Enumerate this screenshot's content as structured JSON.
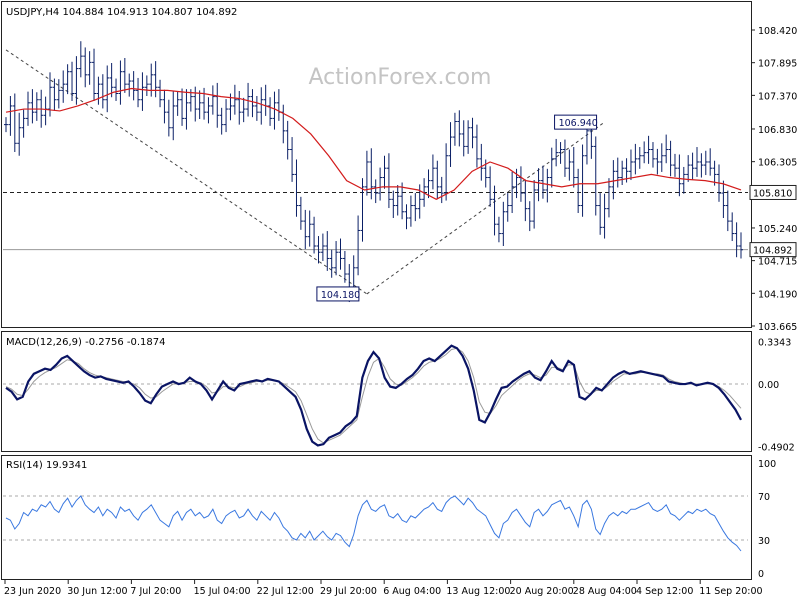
{
  "symbol_header": "USDJPY,H4  104.884 104.913 104.807 104.892",
  "watermark": "ActionForex.com",
  "colors": {
    "bar": "#0a1f66",
    "ma": "#d31c1c",
    "macd": "#0a1464",
    "signal": "#9a9a9a",
    "rsi": "#3a78e0",
    "label_fill": "#ffffff",
    "label_bg_dark": "#0a1464"
  },
  "chart_data": [
    {
      "type": "line",
      "title": "USDJPY,H4  104.884 104.913 104.807 104.892",
      "ylim": [
        103.665,
        108.42
      ],
      "y_ticks": [
        "108.420",
        "107.895",
        "107.370",
        "106.830",
        "106.305",
        "105.240",
        "104.715",
        "104.190",
        "103.665"
      ],
      "y_tick_values": [
        108.42,
        107.895,
        107.37,
        106.83,
        106.305,
        105.24,
        104.715,
        104.19,
        103.665
      ],
      "x_ticks": [
        "23 Jun 2020",
        "30 Jun 12:00",
        "7 Jul 20:00",
        "15 Jul 04:00",
        "22 Jul 12:00",
        "29 Jul 20:00",
        "6 Aug 04:00",
        "13 Aug 12:00",
        "20 Aug 20:00",
        "28 Aug 04:00",
        "4 Sep 12:00",
        "11 Sep 20:00"
      ],
      "series": [
        {
          "kind": "ohlc-bars",
          "close": [
            106.9,
            107.2,
            106.6,
            106.85,
            107.0,
            107.25,
            107.1,
            107.3,
            107.05,
            107.15,
            107.5,
            107.3,
            107.45,
            107.55,
            107.75,
            107.4,
            107.8,
            108.0,
            107.7,
            107.9,
            107.4,
            107.55,
            107.3,
            107.65,
            107.5,
            107.4,
            107.75,
            107.55,
            107.6,
            107.45,
            107.3,
            107.5,
            107.55,
            107.7,
            107.5,
            107.3,
            107.1,
            106.85,
            107.2,
            107.3,
            107.0,
            107.25,
            107.35,
            107.15,
            107.25,
            107.1,
            107.2,
            107.35,
            107.05,
            106.9,
            107.15,
            107.2,
            107.3,
            107.1,
            107.15,
            107.35,
            107.2,
            107.1,
            107.3,
            107.2,
            107.0,
            107.25,
            107.1,
            106.8,
            106.5,
            106.1,
            105.6,
            105.35,
            105.1,
            105.3,
            104.95,
            104.85,
            104.95,
            104.75,
            104.6,
            104.85,
            104.75,
            104.5,
            104.25,
            104.6,
            105.2,
            105.9,
            106.3,
            105.9,
            105.8,
            106.05,
            106.2,
            105.7,
            105.6,
            105.75,
            105.5,
            105.4,
            105.6,
            105.55,
            105.7,
            105.9,
            106.0,
            106.2,
            105.9,
            105.8,
            106.4,
            106.7,
            106.95,
            106.75,
            106.55,
            106.85,
            106.7,
            106.35,
            106.2,
            106.05,
            105.7,
            105.3,
            105.15,
            105.5,
            105.6,
            105.9,
            106.05,
            105.8,
            105.55,
            105.35,
            105.85,
            106.0,
            105.85,
            106.05,
            106.35,
            106.45,
            106.5,
            106.2,
            106.3,
            106.05,
            105.6,
            106.4,
            106.8,
            106.55,
            105.6,
            105.25,
            105.55,
            105.9,
            106.15,
            106.05,
            106.2,
            106.15,
            106.3,
            106.35,
            106.4,
            106.45,
            106.5,
            106.35,
            106.3,
            106.4,
            106.5,
            106.25,
            106.2,
            105.95,
            106.1,
            106.25,
            106.2,
            106.3,
            106.25,
            106.3,
            106.2,
            106.1,
            105.8,
            105.6,
            105.35,
            105.15,
            104.95,
            104.89
          ],
          "low_marked": 104.18,
          "high_marked": 106.94
        },
        {
          "kind": "moving-average",
          "values": [
            107.1,
            107.15,
            107.15,
            107.12,
            107.2,
            107.3,
            107.42,
            107.48,
            107.45,
            107.45,
            107.42,
            107.4,
            107.35,
            107.32,
            107.25,
            107.15,
            107.0,
            106.75,
            106.4,
            106.0,
            105.85,
            105.9,
            105.9,
            105.85,
            105.7,
            105.85,
            106.15,
            106.3,
            106.2,
            106.0,
            105.95,
            105.9,
            105.95,
            105.95,
            106.0,
            106.05,
            106.1,
            106.05,
            106.02,
            106.0,
            105.95,
            105.85
          ],
          "segments": 42
        }
      ],
      "horizontal_lines": [
        {
          "value": 105.81,
          "style": "dashed",
          "label": "105.810"
        },
        {
          "value": 104.892,
          "style": "solid",
          "label": "104.892"
        }
      ],
      "annotations": [
        {
          "text": "106.940",
          "y": 106.94
        },
        {
          "text": "104.180",
          "y": 104.18
        }
      ],
      "trendlines": [
        {
          "from": [
            0,
            108.1
          ],
          "to": [
            82,
            104.18
          ]
        },
        {
          "from": [
            82,
            104.18
          ],
          "to": [
            136,
            106.94
          ]
        }
      ]
    },
    {
      "type": "line",
      "title": "MACD(12,26,9) -0.2756 -0.1874",
      "ylim": [
        -0.5,
        0.36
      ],
      "y_ticks": [
        "0.3343",
        "0.00",
        "-0.4902"
      ],
      "y_tick_values": [
        0.3343,
        0.0,
        -0.4902
      ],
      "series": [
        {
          "name": "MACD",
          "values": [
            -0.03,
            -0.06,
            -0.12,
            -0.1,
            0.02,
            0.08,
            0.1,
            0.12,
            0.11,
            0.15,
            0.2,
            0.22,
            0.18,
            0.14,
            0.1,
            0.07,
            0.05,
            0.06,
            0.04,
            0.03,
            0.02,
            0.01,
            0.02,
            -0.02,
            -0.07,
            -0.13,
            -0.15,
            -0.08,
            -0.02,
            0.0,
            0.02,
            0.0,
            0.01,
            0.05,
            0.02,
            0.0,
            -0.05,
            -0.12,
            -0.05,
            0.02,
            -0.03,
            -0.05,
            0.0,
            0.01,
            0.02,
            0.03,
            0.02,
            0.04,
            0.03,
            0.02,
            -0.02,
            -0.06,
            -0.1,
            -0.2,
            -0.35,
            -0.45,
            -0.48,
            -0.47,
            -0.42,
            -0.4,
            -0.38,
            -0.33,
            -0.3,
            -0.25,
            0.05,
            0.18,
            0.25,
            0.2,
            0.05,
            -0.02,
            -0.03,
            0.0,
            0.04,
            0.07,
            0.12,
            0.18,
            0.2,
            0.18,
            0.22,
            0.26,
            0.3,
            0.28,
            0.22,
            0.12,
            -0.05,
            -0.28,
            -0.3,
            -0.22,
            -0.12,
            -0.03,
            -0.02,
            0.02,
            0.05,
            0.08,
            0.1,
            0.05,
            0.03,
            0.1,
            0.18,
            0.12,
            0.1,
            0.18,
            0.15,
            -0.1,
            -0.12,
            -0.08,
            -0.03,
            -0.05,
            0.0,
            0.05,
            0.08,
            0.1,
            0.08,
            0.09,
            0.1,
            0.09,
            0.08,
            0.07,
            0.06,
            0.02,
            0.01,
            0.0,
            0.0,
            0.01,
            -0.01,
            0.0,
            0.01,
            0.0,
            -0.03,
            -0.08,
            -0.14,
            -0.2,
            -0.28
          ]
        },
        {
          "name": "Signal",
          "values": [
            -0.02,
            -0.04,
            -0.08,
            -0.09,
            -0.04,
            0.02,
            0.06,
            0.09,
            0.11,
            0.13,
            0.16,
            0.19,
            0.18,
            0.16,
            0.12,
            0.09,
            0.07,
            0.06,
            0.05,
            0.04,
            0.03,
            0.02,
            0.01,
            0.0,
            -0.03,
            -0.08,
            -0.11,
            -0.1,
            -0.06,
            -0.03,
            0.0,
            0.0,
            0.01,
            0.02,
            0.02,
            0.01,
            -0.02,
            -0.07,
            -0.06,
            -0.02,
            -0.02,
            -0.03,
            -0.02,
            0.0,
            0.01,
            0.02,
            0.02,
            0.03,
            0.03,
            0.02,
            0.0,
            -0.03,
            -0.06,
            -0.13,
            -0.24,
            -0.35,
            -0.43,
            -0.46,
            -0.44,
            -0.42,
            -0.4,
            -0.36,
            -0.32,
            -0.28,
            -0.1,
            0.06,
            0.17,
            0.2,
            0.13,
            0.04,
            0.0,
            -0.01,
            0.02,
            0.05,
            0.09,
            0.14,
            0.17,
            0.18,
            0.2,
            0.23,
            0.27,
            0.28,
            0.25,
            0.18,
            0.05,
            -0.14,
            -0.22,
            -0.23,
            -0.17,
            -0.09,
            -0.05,
            -0.01,
            0.03,
            0.06,
            0.08,
            0.07,
            0.05,
            0.07,
            0.13,
            0.13,
            0.11,
            0.15,
            0.15,
            0.02,
            -0.06,
            -0.08,
            -0.05,
            -0.05,
            -0.02,
            0.02,
            0.05,
            0.08,
            0.08,
            0.08,
            0.09,
            0.09,
            0.08,
            0.08,
            0.07,
            0.04,
            0.02,
            0.01,
            0.0,
            0.0,
            0.0,
            0.0,
            0.0,
            0.0,
            -0.02,
            -0.05,
            -0.09,
            -0.14,
            -0.19
          ]
        }
      ]
    },
    {
      "type": "line",
      "title": "RSI(14) 19.9341",
      "ylim": [
        0,
        100
      ],
      "y_ticks": [
        "100",
        "70",
        "30",
        "0"
      ],
      "y_tick_values": [
        100,
        70,
        30,
        0
      ],
      "levels": [
        70,
        30
      ],
      "series": [
        {
          "name": "RSI",
          "values": [
            50,
            48,
            40,
            45,
            55,
            52,
            58,
            56,
            62,
            60,
            65,
            58,
            55,
            63,
            68,
            60,
            66,
            70,
            62,
            58,
            55,
            60,
            52,
            58,
            55,
            50,
            60,
            56,
            58,
            52,
            48,
            55,
            58,
            62,
            55,
            48,
            45,
            42,
            52,
            56,
            48,
            55,
            58,
            52,
            55,
            50,
            52,
            58,
            48,
            45,
            52,
            55,
            57,
            50,
            52,
            58,
            52,
            48,
            56,
            52,
            48,
            55,
            50,
            42,
            38,
            32,
            30,
            36,
            32,
            38,
            30,
            34,
            38,
            33,
            30,
            36,
            34,
            28,
            24,
            35,
            52,
            62,
            66,
            58,
            56,
            60,
            62,
            52,
            50,
            54,
            48,
            46,
            52,
            50,
            54,
            58,
            60,
            64,
            58,
            56,
            64,
            68,
            70,
            66,
            62,
            68,
            64,
            58,
            55,
            52,
            44,
            36,
            32,
            45,
            48,
            55,
            58,
            52,
            46,
            42,
            55,
            58,
            52,
            56,
            62,
            64,
            66,
            58,
            60,
            52,
            42,
            62,
            66,
            58,
            40,
            35,
            45,
            52,
            55,
            52,
            56,
            54,
            58,
            58,
            60,
            62,
            64,
            58,
            56,
            58,
            62,
            54,
            52,
            48,
            52,
            56,
            54,
            58,
            56,
            58,
            54,
            52,
            45,
            38,
            32,
            28,
            25,
            20
          ]
        }
      ]
    }
  ]
}
